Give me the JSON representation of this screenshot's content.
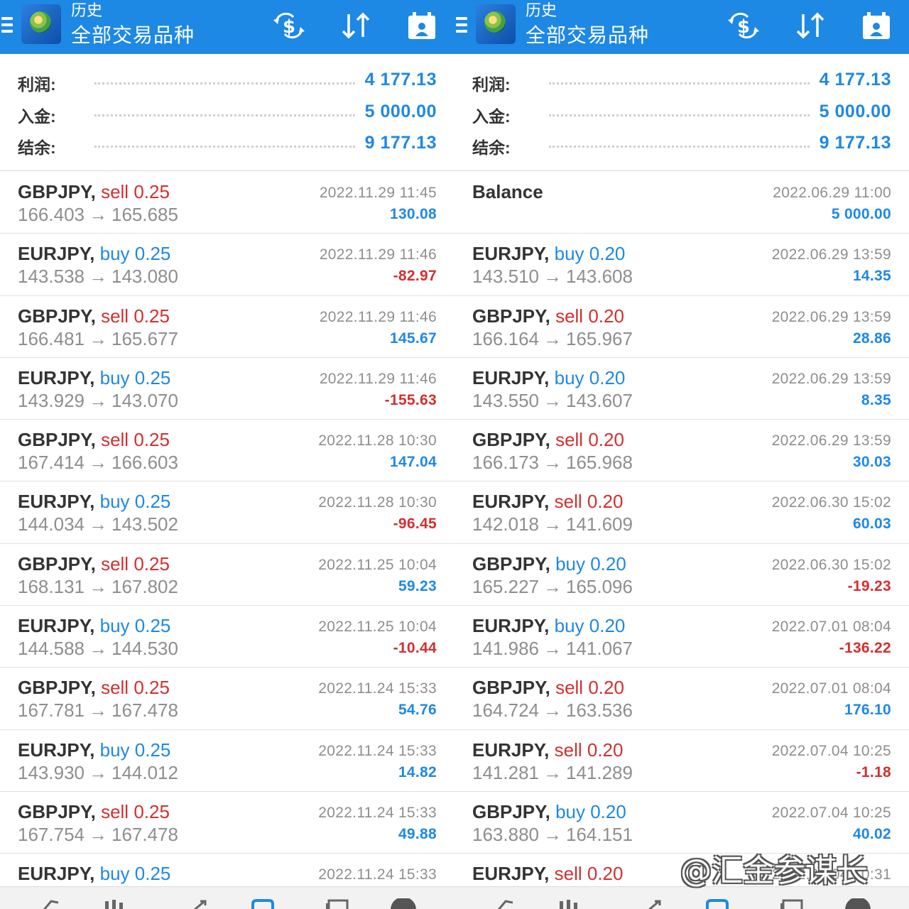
{
  "header": {
    "title": "历史",
    "subtitle": "全部交易品种",
    "icons": [
      "menu-icon",
      "app-logo-icon",
      "dollar-exchange-icon",
      "sort-icon",
      "calendar-icon"
    ]
  },
  "colors": {
    "header_bg": "#1e88e5",
    "accent_blue": "#1e88e5",
    "loss_red": "#d32f2f",
    "text_dark": "#333333",
    "text_grey": "#8e8e8e"
  },
  "watermark": "@汇金参谋长",
  "panels": [
    {
      "summary": [
        {
          "label": "利润:",
          "value": "4 177.13"
        },
        {
          "label": "入金:",
          "value": "5 000.00"
        },
        {
          "label": "结余:",
          "value": "9 177.13"
        }
      ],
      "trades": [
        {
          "symbol": "GBPJPY,",
          "type": "sell",
          "volume": "0.25",
          "open": "166.403",
          "close": "165.685",
          "date": "2022.11.29 11:45",
          "profit": "130.08"
        },
        {
          "symbol": "EURJPY,",
          "type": "buy",
          "volume": "0.25",
          "open": "143.538",
          "close": "143.080",
          "date": "2022.11.29 11:46",
          "profit": "-82.97"
        },
        {
          "symbol": "GBPJPY,",
          "type": "sell",
          "volume": "0.25",
          "open": "166.481",
          "close": "165.677",
          "date": "2022.11.29 11:46",
          "profit": "145.67"
        },
        {
          "symbol": "EURJPY,",
          "type": "buy",
          "volume": "0.25",
          "open": "143.929",
          "close": "143.070",
          "date": "2022.11.29 11:46",
          "profit": "-155.63"
        },
        {
          "symbol": "GBPJPY,",
          "type": "sell",
          "volume": "0.25",
          "open": "167.414",
          "close": "166.603",
          "date": "2022.11.28 10:30",
          "profit": "147.04"
        },
        {
          "symbol": "EURJPY,",
          "type": "buy",
          "volume": "0.25",
          "open": "144.034",
          "close": "143.502",
          "date": "2022.11.28 10:30",
          "profit": "-96.45"
        },
        {
          "symbol": "GBPJPY,",
          "type": "sell",
          "volume": "0.25",
          "open": "168.131",
          "close": "167.802",
          "date": "2022.11.25 10:04",
          "profit": "59.23"
        },
        {
          "symbol": "EURJPY,",
          "type": "buy",
          "volume": "0.25",
          "open": "144.588",
          "close": "144.530",
          "date": "2022.11.25 10:04",
          "profit": "-10.44"
        },
        {
          "symbol": "GBPJPY,",
          "type": "sell",
          "volume": "0.25",
          "open": "167.781",
          "close": "167.478",
          "date": "2022.11.24 15:33",
          "profit": "54.76"
        },
        {
          "symbol": "EURJPY,",
          "type": "buy",
          "volume": "0.25",
          "open": "143.930",
          "close": "144.012",
          "date": "2022.11.24 15:33",
          "profit": "14.82"
        },
        {
          "symbol": "GBPJPY,",
          "type": "sell",
          "volume": "0.25",
          "open": "167.754",
          "close": "167.478",
          "date": "2022.11.24 15:33",
          "profit": "49.88"
        },
        {
          "symbol": "EURJPY,",
          "type": "buy",
          "volume": "0.25",
          "open": "",
          "close": "",
          "date": "2022.11.24 15:33",
          "profit": ""
        }
      ]
    },
    {
      "summary": [
        {
          "label": "利润:",
          "value": "4 177.13"
        },
        {
          "label": "入金:",
          "value": "5 000.00"
        },
        {
          "label": "结余:",
          "value": "9 177.13"
        }
      ],
      "trades": [
        {
          "symbol": "Balance",
          "type": "",
          "volume": "",
          "open": "",
          "close": "",
          "date": "2022.06.29 11:00",
          "profit": "5 000.00"
        },
        {
          "symbol": "EURJPY,",
          "type": "buy",
          "volume": "0.20",
          "open": "143.510",
          "close": "143.608",
          "date": "2022.06.29 13:59",
          "profit": "14.35"
        },
        {
          "symbol": "GBPJPY,",
          "type": "sell",
          "volume": "0.20",
          "open": "166.164",
          "close": "165.967",
          "date": "2022.06.29 13:59",
          "profit": "28.86"
        },
        {
          "symbol": "EURJPY,",
          "type": "buy",
          "volume": "0.20",
          "open": "143.550",
          "close": "143.607",
          "date": "2022.06.29 13:59",
          "profit": "8.35"
        },
        {
          "symbol": "GBPJPY,",
          "type": "sell",
          "volume": "0.20",
          "open": "166.173",
          "close": "165.968",
          "date": "2022.06.29 13:59",
          "profit": "30.03"
        },
        {
          "symbol": "EURJPY,",
          "type": "sell",
          "volume": "0.20",
          "open": "142.018",
          "close": "141.609",
          "date": "2022.06.30 15:02",
          "profit": "60.03"
        },
        {
          "symbol": "GBPJPY,",
          "type": "buy",
          "volume": "0.20",
          "open": "165.227",
          "close": "165.096",
          "date": "2022.06.30 15:02",
          "profit": "-19.23"
        },
        {
          "symbol": "EURJPY,",
          "type": "buy",
          "volume": "0.20",
          "open": "141.986",
          "close": "141.067",
          "date": "2022.07.01 08:04",
          "profit": "-136.22"
        },
        {
          "symbol": "GBPJPY,",
          "type": "sell",
          "volume": "0.20",
          "open": "164.724",
          "close": "163.536",
          "date": "2022.07.01 08:04",
          "profit": "176.10"
        },
        {
          "symbol": "EURJPY,",
          "type": "sell",
          "volume": "0.20",
          "open": "141.281",
          "close": "141.289",
          "date": "2022.07.04 10:25",
          "profit": "-1.18"
        },
        {
          "symbol": "GBPJPY,",
          "type": "buy",
          "volume": "0.20",
          "open": "163.880",
          "close": "164.151",
          "date": "2022.07.04 10:25",
          "profit": "40.02"
        },
        {
          "symbol": "EURJPY,",
          "type": "sell",
          "volume": "0.20",
          "open": "",
          "close": "",
          "date": "2022.07.04 10:31",
          "profit": ""
        }
      ]
    }
  ],
  "bottom_nav": [
    "quotes-icon",
    "chart-icon",
    "trade-icon",
    "history-icon",
    "news-icon",
    "settings-icon"
  ]
}
